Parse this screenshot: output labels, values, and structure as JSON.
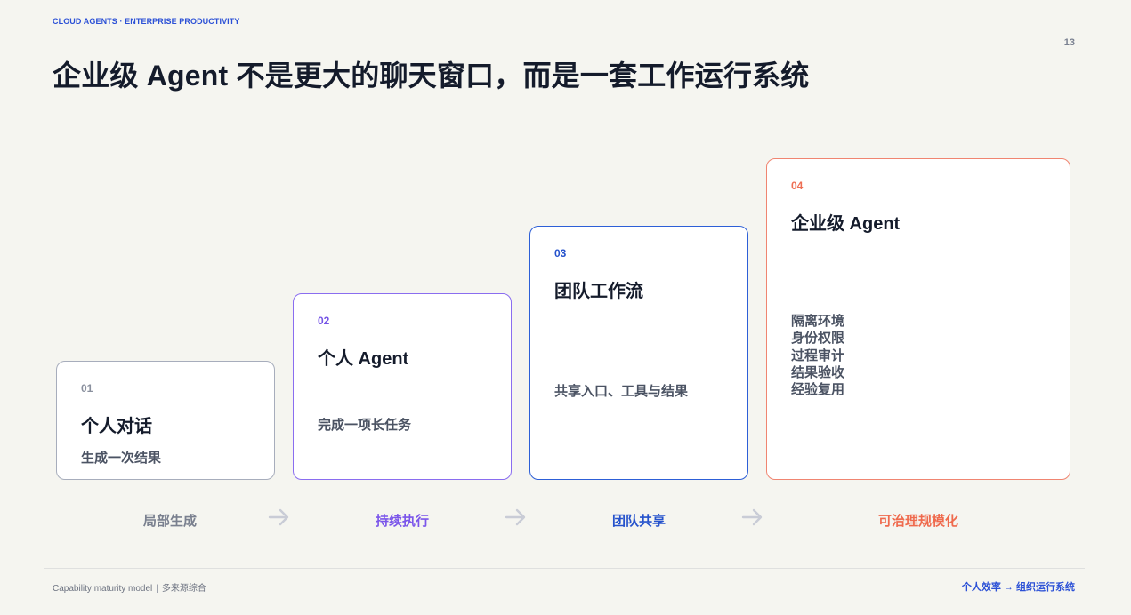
{
  "header": {
    "kicker": "CLOUD AGENTS · ENTERPRISE PRODUCTIVITY",
    "page_number": "13",
    "title": "企业级 Agent 不是更大的聊天窗口，而是一套工作运行系统"
  },
  "cards": [
    {
      "number": "01",
      "title": "个人对话",
      "description": "生成一次结果",
      "color": "#a7adbc"
    },
    {
      "number": "02",
      "title": "个人 Agent",
      "description": "完成一项长任务",
      "color": "#8a6df0"
    },
    {
      "number": "03",
      "title": "团队工作流",
      "description": "共享入口、工具与结果",
      "color": "#2d5fd7"
    },
    {
      "number": "04",
      "title": "企业级 Agent",
      "items": [
        "隔离环境",
        "身份权限",
        "过程审计",
        "结果验收",
        "经验复用"
      ],
      "color": "#f08571"
    }
  ],
  "stages": [
    {
      "label": "局部生成",
      "color": "#7a808f"
    },
    {
      "label": "持续执行",
      "color": "#7b56ea"
    },
    {
      "label": "团队共享",
      "color": "#2552cc"
    },
    {
      "label": "可治理规模化",
      "color": "#ef6a4d"
    }
  ],
  "arrow_icon": "arrow-right-icon",
  "footer": {
    "source": "Capability maturity model",
    "separator": "|",
    "source_note": "多来源综合",
    "tagline": "个人效率 → 组织运行系统"
  }
}
